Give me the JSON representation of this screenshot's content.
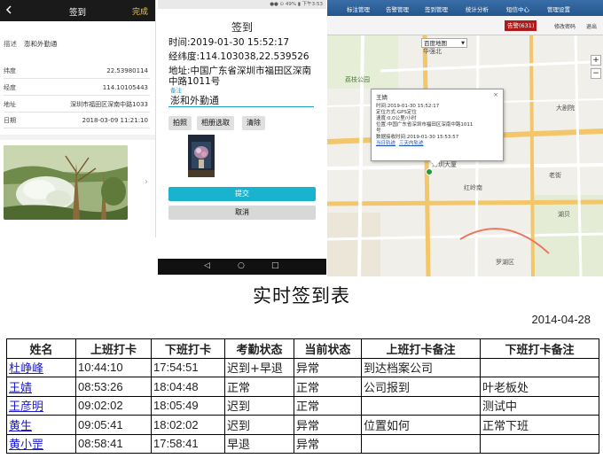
{
  "phone_left": {
    "back_icon": "chevron-left-icon",
    "title": "签到",
    "done_label": "完成",
    "description_label": "描述",
    "description_value": "澎和外勤通",
    "rows": [
      {
        "key": "纬度",
        "value": "22.53980114"
      },
      {
        "key": "经度",
        "value": "114.10105443"
      },
      {
        "key": "地址",
        "value": "深圳市福田区深南中路1033"
      },
      {
        "key": "日期",
        "value": "2018-03-09 11:21:10"
      }
    ],
    "next_icon": "chevron-right-icon"
  },
  "phone_middle": {
    "status_bar": "●● ⊙ 49% ▮ 下午3:53",
    "title": "签到",
    "time_line": "时间:2019-01-30 15:52:17",
    "coord_line": "经纬度:114.103038,22.539526",
    "address_line1": "地址:中国广东省深圳市福田区深南",
    "address_line2": "中路1011号",
    "note_label": "备注",
    "note_value": "澎和外勤通",
    "buttons": {
      "photo": "拍照",
      "album": "相册选取",
      "clear": "清除"
    },
    "submit_label": "提交",
    "cancel_label": "取消",
    "nav": {
      "back": "◁",
      "home": "○",
      "recent": "□"
    }
  },
  "web_map": {
    "menu": [
      "标注管理",
      "告警管理",
      "签到管理",
      "统计分析",
      "短信中心",
      "管理设置"
    ],
    "alarm_label": "告警(631)",
    "links": [
      "修改密码",
      "退出"
    ],
    "map_type": "百度地图",
    "popup": {
      "name": "王婧",
      "lines": [
        "时间:2019-01-30 15:52:17",
        "定位方式:GPS定位",
        "速度:0.0公里/小时",
        "位置:中国广东省深圳市福田区深南中路1011",
        "号",
        "数据接收时间:2019-01-30 15:53:57"
      ],
      "link1": "当日轨迹",
      "link2": "三天内轨迹",
      "close": "×"
    },
    "zoom_in": "+",
    "zoom_out": "−",
    "place_labels": [
      "大剧院",
      "红岭南",
      "华强北",
      "深圳大厦",
      "荔枝公园",
      "老街",
      "湖贝",
      "罗湖区"
    ]
  },
  "report": {
    "title": "实时签到表",
    "date": "2014-04-28",
    "columns": [
      "姓名",
      "上班打卡",
      "下班打卡",
      "考勤状态",
      "当前状态",
      "上班打卡备注",
      "下班打卡备注"
    ],
    "rows": [
      [
        "杜峥峰",
        "10:44:10",
        "17:54:51",
        "迟到+早退",
        "异常",
        "到达档案公司",
        ""
      ],
      [
        "王婧",
        "08:53:26",
        "18:04:48",
        "正常",
        "正常",
        "公司报到",
        "叶老板处"
      ],
      [
        "王彦明",
        "09:02:02",
        "18:05:49",
        "迟到",
        "正常",
        "",
        "测试中"
      ],
      [
        "黄生",
        "09:05:41",
        "18:02:02",
        "迟到",
        "异常",
        "位置如何",
        "正常下班"
      ],
      [
        "黄小罡",
        "08:58:41",
        "17:58:41",
        "早退",
        "异常",
        "",
        ""
      ]
    ]
  }
}
